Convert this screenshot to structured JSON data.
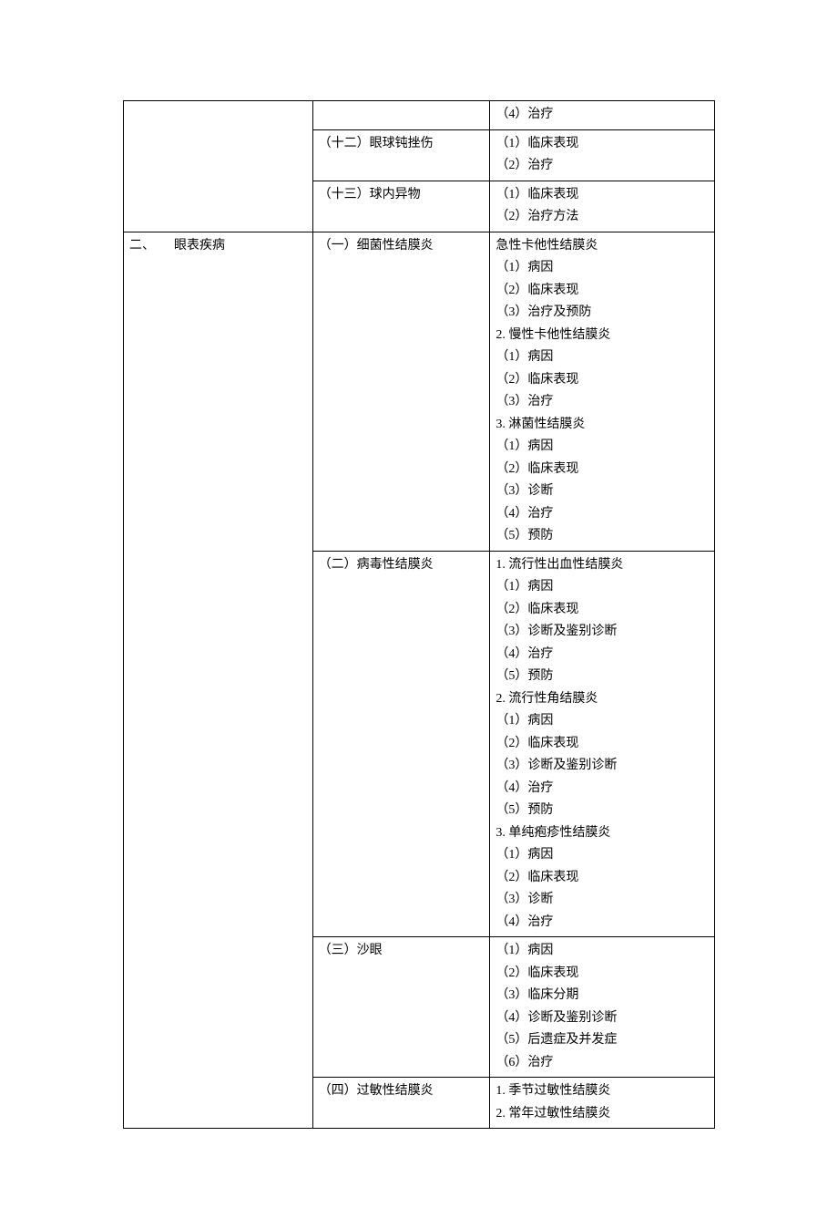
{
  "rows": [
    {
      "c1": [],
      "c2": [],
      "c3": [
        "（4）治疗"
      ]
    },
    {
      "c1": [],
      "c2": [
        "（十二）眼球钝挫伤"
      ],
      "c3": [
        "（1）临床表现",
        "（2）治疗"
      ]
    },
    {
      "c1": [],
      "c2": [
        "（十三）球内异物"
      ],
      "c3": [
        "（1）临床表现",
        "（2）治疗方法"
      ]
    },
    {
      "c1": [
        "二、　　眼表疾病"
      ],
      "c2": [
        "（一）细菌性结膜炎"
      ],
      "c3": [
        "急性卡他性结膜炎",
        "（1）病因",
        "（2）临床表现",
        "（3）治疗及预防",
        "2. 慢性卡他性结膜炎",
        "（1）病因",
        "（2）临床表现",
        "（3）治疗",
        "3. 淋菌性结膜炎",
        "（1）病因",
        "（2）临床表现",
        "（3）诊断",
        "（4）治疗",
        "（5）预防"
      ]
    },
    {
      "c1": [],
      "c2": [
        "（二）病毒性结膜炎"
      ],
      "c3": [
        "1. 流行性出血性结膜炎",
        "（1）病因",
        "（2）临床表现",
        "（3）诊断及鉴别诊断",
        "（4）治疗",
        "（5）预防",
        "2. 流行性角结膜炎",
        "（1）病因",
        "（2）临床表现",
        "（3）诊断及鉴别诊断",
        "（4）治疗",
        "（5）预防",
        "3. 单纯疱疹性结膜炎",
        "（1）病因",
        "（2）临床表现",
        "（3）诊断",
        "（4）治疗"
      ]
    },
    {
      "c1": [],
      "c2": [
        "（三）沙眼"
      ],
      "c3": [
        "（1）病因",
        "（2）临床表现",
        "（3）临床分期",
        "（4）诊断及鉴别诊断",
        "（5）后遗症及并发症",
        "（6）治疗"
      ]
    },
    {
      "c1": [],
      "c2": [
        "（四）过敏性结膜炎"
      ],
      "c3": [
        "1. 季节过敏性结膜炎",
        "2. 常年过敏性结膜炎"
      ]
    }
  ]
}
